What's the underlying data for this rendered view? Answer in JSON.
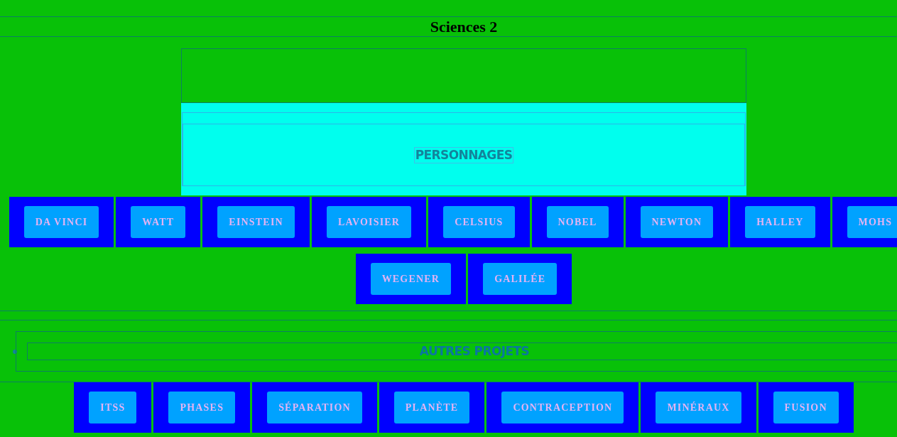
{
  "title": "Sciences 2",
  "sections": [
    {
      "kind": "panel",
      "heading": "PERSONNAGES",
      "buttons": [
        "DA VINCI",
        "WATT",
        "EINSTEIN",
        "LAVOISIER",
        "CELSIUS",
        "NOBEL",
        "NEWTON",
        "HALLEY",
        "MOHS",
        "WEGENER",
        "GALILÉE"
      ]
    },
    {
      "kind": "bullet",
      "heading": "AUTRES PROJETS",
      "buttons": [
        "ITSS",
        "PHASES",
        "SÉPARATION",
        "PLANÈTE",
        "CONTRACEPTION",
        "MINÉRAUX",
        "FUSION"
      ]
    }
  ]
}
